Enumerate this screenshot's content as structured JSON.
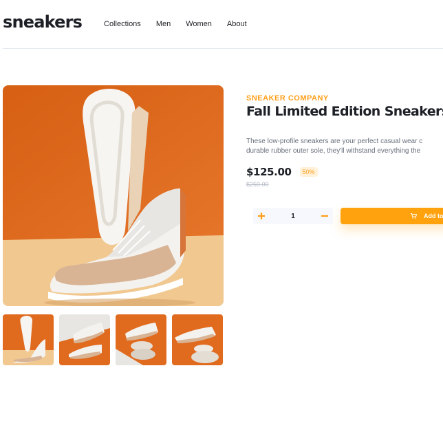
{
  "brand": {
    "logo": "sneakers"
  },
  "nav": {
    "items": [
      "Collections",
      "Men",
      "Women",
      "About"
    ]
  },
  "product": {
    "company": "SNEAKER COMPANY",
    "title": "Fall Limited Edition Sneakers",
    "description_line1": "These low-profile sneakers are your perfect casual wear c",
    "description_line2": "durable rubber outer sole, they'll withstand everything the",
    "price": "$125.00",
    "discount": "50%",
    "old_price": "$250.00"
  },
  "cart": {
    "quantity": "1",
    "add_label": "Add to"
  },
  "colors": {
    "accent": "#ffa20e",
    "text_dark": "#1d2026",
    "text_muted": "#69707d"
  },
  "icons": {
    "increment": "plus-icon",
    "decrement": "minus-icon",
    "cart": "cart-icon"
  }
}
